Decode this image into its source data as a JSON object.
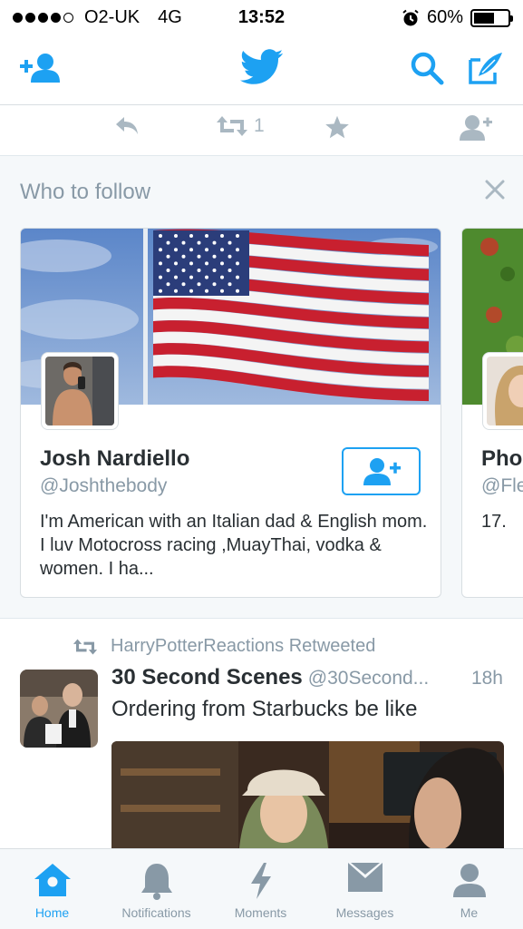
{
  "status_bar": {
    "carrier": "O2-UK",
    "network": "4G",
    "time": "13:52",
    "battery": "60%",
    "battery_level": 0.6,
    "icons": [
      "signal-dots-icon",
      "alarm-icon",
      "battery-icon"
    ]
  },
  "nav": {
    "icons": [
      "add-user-icon",
      "twitter-bird-icon",
      "search-icon",
      "compose-icon"
    ]
  },
  "tweet_actions": {
    "retweet_count": "1",
    "icons": [
      "reply-icon",
      "retweet-icon",
      "like-star-icon",
      "follow-icon"
    ]
  },
  "who_to_follow": {
    "title": "Who to follow",
    "cards": [
      {
        "name": "Josh Nardiello",
        "handle": "@Joshthebody",
        "bio": "I'm American with an Italian dad & English mom. I luv Motocross racing ,MuayThai, vodka & women. I ha..."
      },
      {
        "name": "Pho",
        "handle": "@Fle",
        "bio": "17."
      }
    ]
  },
  "timeline_tweet": {
    "retweeted_by": "HarryPotterReactions Retweeted",
    "name": "30 Second Scenes",
    "handle": "@30Second...",
    "time": "18h",
    "text": "Ordering from Starbucks be like"
  },
  "tabs": [
    {
      "label": "Home",
      "icon": "home-icon",
      "active": true
    },
    {
      "label": "Notifications",
      "icon": "bell-icon",
      "active": false
    },
    {
      "label": "Moments",
      "icon": "lightning-icon",
      "active": false
    },
    {
      "label": "Messages",
      "icon": "envelope-icon",
      "active": false
    },
    {
      "label": "Me",
      "icon": "person-icon",
      "active": false
    }
  ],
  "colors": {
    "accent": "#1da1f2",
    "muted": "#8899a6",
    "inactive_icon": "#aab8c2",
    "background": "#f5f8fa"
  }
}
